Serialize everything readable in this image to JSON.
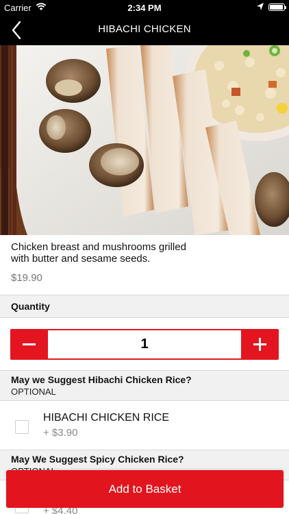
{
  "status_bar": {
    "carrier": "Carrier",
    "time": "2:34 PM"
  },
  "nav": {
    "title": "HIBACHI CHICKEN"
  },
  "product": {
    "description": "Chicken breast and mushrooms grilled with butter and sesame seeds.",
    "price": "$19.90"
  },
  "quantity": {
    "label": "Quantity",
    "value": "1",
    "minus": "−",
    "plus": "+"
  },
  "option_groups": [
    {
      "title": "May we Suggest Hibachi Chicken Rice?",
      "subtitle": "OPTIONAL",
      "items": [
        {
          "name": "HIBACHI CHICKEN RICE",
          "price": "+ $3.90",
          "checked": false
        }
      ]
    },
    {
      "title": "May We Suggest Spicy Chicken Rice?",
      "subtitle": "OPTIONAL",
      "items": [
        {
          "name": "",
          "price": "+ $4.40",
          "checked": false
        }
      ]
    }
  ],
  "cta": {
    "label": "Add to Basket"
  },
  "colors": {
    "accent": "#e2141d",
    "nav_bg": "#000000",
    "section_bg": "#f1f1f1"
  },
  "icons": {
    "back": "chevron-left-icon",
    "wifi": "wifi-icon",
    "location": "location-arrow-icon",
    "battery": "battery-icon"
  }
}
